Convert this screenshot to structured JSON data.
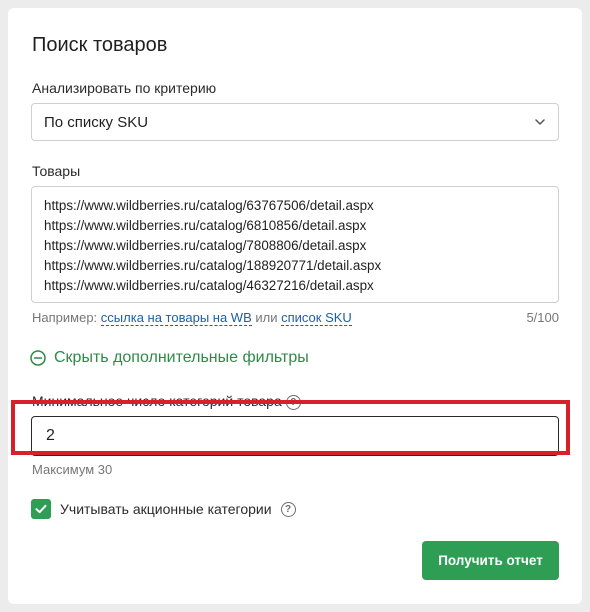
{
  "form": {
    "title": "Поиск товаров",
    "criterion_label": "Анализировать по критерию",
    "criterion_value": "По списку SKU",
    "goods_label": "Товары",
    "goods_lines": [
      "https://www.wildberries.ru/catalog/63767506/detail.aspx",
      "https://www.wildberries.ru/catalog/6810856/detail.aspx",
      "https://www.wildberries.ru/catalog/7808806/detail.aspx",
      "https://www.wildberries.ru/catalog/188920771/detail.aspx",
      "https://www.wildberries.ru/catalog/46327216/detail.aspx"
    ],
    "hint_prefix": "Например:",
    "hint_link1": "ссылка на товары на WB",
    "hint_or": "или",
    "hint_link2": "список SKU",
    "counter": "5/100",
    "toggle_filters": "Скрыть дополнительные фильтры",
    "min_categories_label": "Минимальное число категорий товара",
    "min_categories_value": "2",
    "max_hint": "Максимум 30",
    "promo_label": "Учитывать акционные категории",
    "submit_label": "Получить отчет"
  },
  "icons": {
    "select": "chevron-down-icon",
    "toggle": "minus-circle-icon",
    "help": "question-circle-icon",
    "check": "checkmark-icon"
  },
  "colors": {
    "accent_green": "#2e9e55",
    "link_blue": "#1b5fa8",
    "highlight_red": "#d6202a"
  }
}
